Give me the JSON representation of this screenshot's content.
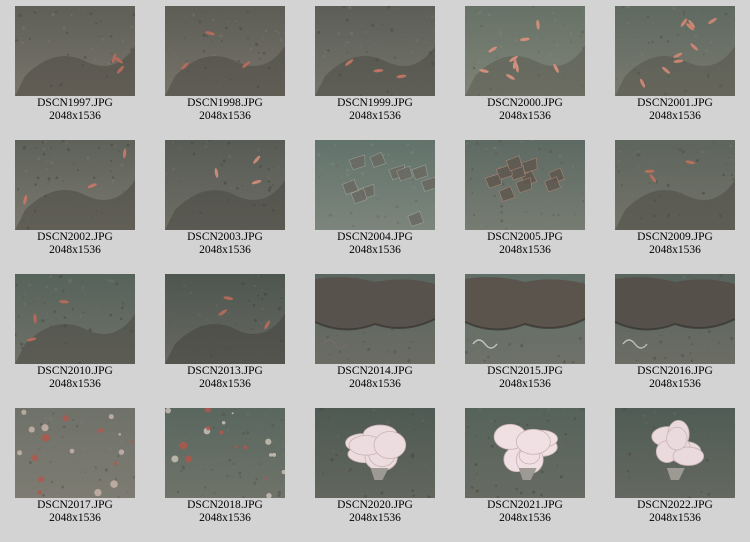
{
  "gallery": {
    "items": [
      {
        "filename": "DSCN1997.JPG",
        "dimensions": "2048x1536",
        "bg": "#5f5f57",
        "floor": "#77746b",
        "rock": "#4e4b44",
        "accent": "#b46a5a",
        "feature": "shrimp"
      },
      {
        "filename": "DSCN1998.JPG",
        "dimensions": "2048x1536",
        "bg": "#5d5d55",
        "floor": "#76736a",
        "rock": "#4d4a43",
        "accent": "#b56b5b",
        "feature": "shrimp"
      },
      {
        "filename": "DSCN1999.JPG",
        "dimensions": "2048x1536",
        "bg": "#5c5e57",
        "floor": "#74746b",
        "rock": "#4c4c45",
        "accent": "#bb7463",
        "feature": "shrimp"
      },
      {
        "filename": "DSCN2000.JPG",
        "dimensions": "2048x1536",
        "bg": "#677267",
        "floor": "#7f8276",
        "rock": "#5b5b52",
        "accent": "#cf8f7a",
        "feature": "shrimp-many"
      },
      {
        "filename": "DSCN2001.JPG",
        "dimensions": "2048x1536",
        "bg": "#5f6a61",
        "floor": "#79796f",
        "rock": "#56554d",
        "accent": "#c88572",
        "feature": "shrimp-many"
      },
      {
        "filename": "DSCN2002.JPG",
        "dimensions": "2048x1536",
        "bg": "#5e625a",
        "floor": "#79776d",
        "rock": "#4c4a43",
        "accent": "#c07766",
        "feature": "shrimp"
      },
      {
        "filename": "DSCN2003.JPG",
        "dimensions": "2048x1536",
        "bg": "#585c55",
        "floor": "#6d6d65",
        "rock": "#4a4943",
        "accent": "#c78a79",
        "feature": "shrimp"
      },
      {
        "filename": "DSCN2004.JPG",
        "dimensions": "2048x1536",
        "bg": "#62736b",
        "floor": "#7c857c",
        "rock": "#6a6a62",
        "accent": "#9fa69c",
        "feature": "rubble"
      },
      {
        "filename": "DSCN2005.JPG",
        "dimensions": "2048x1536",
        "bg": "#5d6a63",
        "floor": "#777c72",
        "rock": "#5e5850",
        "accent": "#b48a78",
        "feature": "rubble"
      },
      {
        "filename": "DSCN2009.JPG",
        "dimensions": "2048x1536",
        "bg": "#5e655d",
        "floor": "#737369",
        "rock": "#4f4d46",
        "accent": "#b56f5d",
        "feature": "shrimp"
      },
      {
        "filename": "DSCN2010.JPG",
        "dimensions": "2048x1536",
        "bg": "#56635b",
        "floor": "#6f7168",
        "rock": "#4d4b44",
        "accent": "#b46a58",
        "feature": "shrimp"
      },
      {
        "filename": "DSCN2013.JPG",
        "dimensions": "2048x1536",
        "bg": "#4e5650",
        "floor": "#676861",
        "rock": "#45443f",
        "accent": "#b06b58",
        "feature": "shrimp"
      },
      {
        "filename": "DSCN2014.JPG",
        "dimensions": "2048x1536",
        "bg": "#59665f",
        "floor": "#6b6c64",
        "rock": "#57524b",
        "accent": "#7a6e62",
        "feature": "boulder"
      },
      {
        "filename": "DSCN2015.JPG",
        "dimensions": "2048x1536",
        "bg": "#5f6e67",
        "floor": "#6e7169",
        "rock": "#5a544c",
        "accent": "#d9dcd6",
        "feature": "boulder"
      },
      {
        "filename": "DSCN2016.JPG",
        "dimensions": "2048x1536",
        "bg": "#57645d",
        "floor": "#6c6d65",
        "rock": "#55514a",
        "accent": "#d2d4cf",
        "feature": "boulder"
      },
      {
        "filename": "DSCN2017.JPG",
        "dimensions": "2048x1536",
        "bg": "#6f726a",
        "floor": "#7d7b72",
        "rock": "#5a5850",
        "accent": "#c7b3a8",
        "feature": "coral"
      },
      {
        "filename": "DSCN2018.JPG",
        "dimensions": "2048x1536",
        "bg": "#59675f",
        "floor": "#6f7369",
        "rock": "#55544d",
        "accent": "#c9c0b6",
        "feature": "coral"
      },
      {
        "filename": "DSCN2020.JPG",
        "dimensions": "2048x1536",
        "bg": "#4e5a53",
        "floor": "#62665e",
        "rock": "#4a4a44",
        "accent": "#ecdce0",
        "feature": "sponge"
      },
      {
        "filename": "DSCN2021.JPG",
        "dimensions": "2048x1536",
        "bg": "#55635b",
        "floor": "#676b62",
        "rock": "#4c4b45",
        "accent": "#f0e0e3",
        "feature": "sponge"
      },
      {
        "filename": "DSCN2022.JPG",
        "dimensions": "2048x1536",
        "bg": "#4f5c55",
        "floor": "#646860",
        "rock": "#4b4a44",
        "accent": "#eadade",
        "feature": "sponge"
      }
    ]
  }
}
